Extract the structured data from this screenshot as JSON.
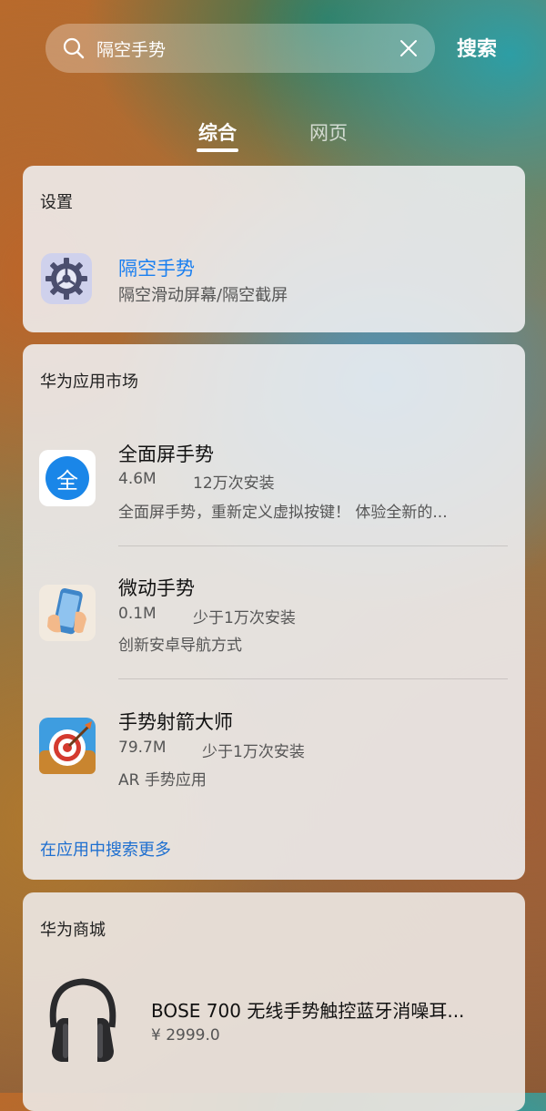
{
  "search": {
    "query": "隔空手势",
    "submit_label": "搜索"
  },
  "tabs": [
    {
      "label": "综合",
      "active": true
    },
    {
      "label": "网页",
      "active": false
    }
  ],
  "settings_card": {
    "title": "设置",
    "item": {
      "name": "隔空手势",
      "description": "隔空滑动屏幕/隔空截屏",
      "icon": "settings-gear-icon"
    }
  },
  "appmarket_card": {
    "title": "华为应用市场",
    "apps": [
      {
        "name": "全面屏手势",
        "size": "4.6M",
        "installs": "12万次安装",
        "description": "全面屏手势，重新定义虚拟按键！ 体验全新的...",
        "icon_glyph": "全",
        "icon": "fullscreen-gesture-app-icon"
      },
      {
        "name": "微动手势",
        "size": "0.1M",
        "installs": "少于1万次安装",
        "description": "创新安卓导航方式",
        "icon": "hand-phone-app-icon"
      },
      {
        "name": "手势射箭大师",
        "size": "79.7M",
        "installs": "少于1万次安装",
        "description": "AR 手势应用",
        "icon": "archery-target-app-icon"
      }
    ],
    "more_label": "在应用中搜索更多"
  },
  "store_card": {
    "title": "华为商城",
    "product": {
      "name": "BOSE 700 无线手势触控蓝牙消噪耳...",
      "price": "¥ 2999.0",
      "icon": "headphones-icon"
    }
  },
  "colors": {
    "link_blue": "#1e6fd0",
    "accent_blue": "#1a7ff0"
  }
}
